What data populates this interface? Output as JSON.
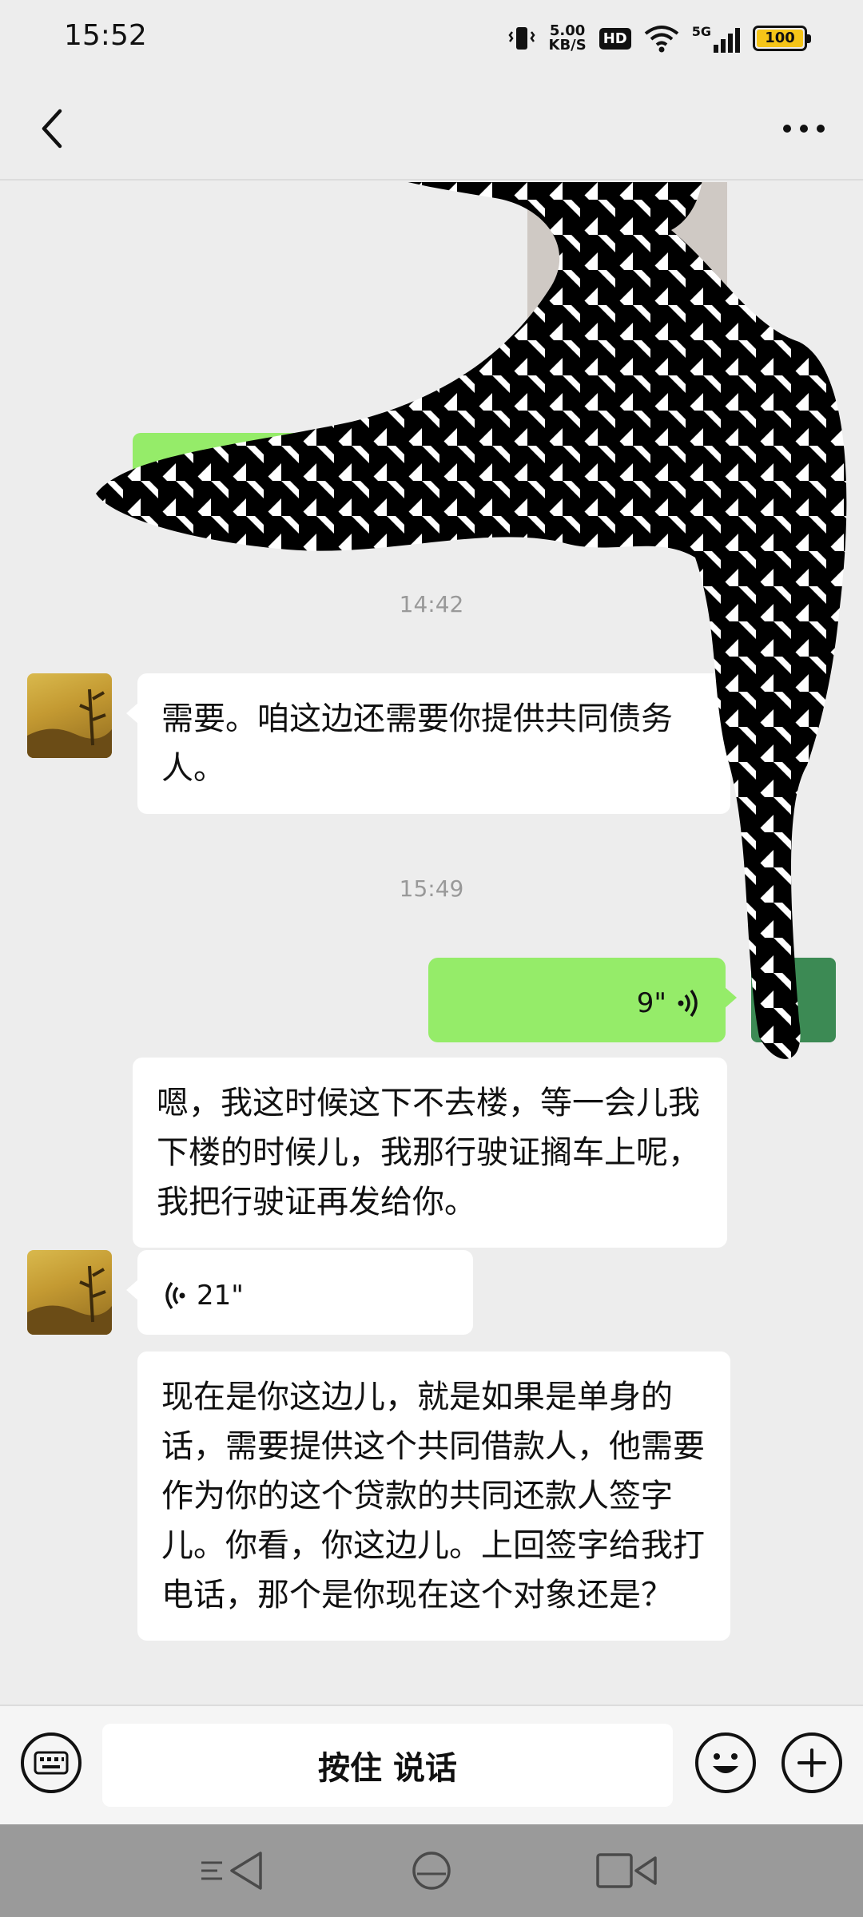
{
  "status_bar": {
    "time": "15:52",
    "net_speed": "5.00",
    "net_unit": "KB/S",
    "hd_badge": "HD",
    "signal_label": "5G",
    "battery": "100"
  },
  "chat": {
    "timestamp_1": "14:42",
    "message_1": "需要。咱这边还需要你提供共同债务人。",
    "timestamp_2": "15:49",
    "voice_out_duration": "9\"",
    "message_2": "嗯，我这时候这下不去楼，等一会儿我下楼的时候儿，我那行驶证搁车上呢，我把行驶证再发给你。",
    "voice_in_duration": "21\"",
    "message_3": "现在是你这边儿，就是如果是单身的话，需要提供这个共同借款人，他需要作为你的这个贷款的共同还款人签字儿。你看，你这边儿。上回签字给我打电话，那个是你现在这个对象还是？"
  },
  "input_bar": {
    "hold_to_talk": "按住 说话"
  },
  "icons": {
    "back": "chevron-left-icon",
    "more": "ellipsis-icon",
    "keyboard": "keyboard-icon",
    "emoji": "smiley-icon",
    "plus": "plus-icon",
    "voice": "voice-wave-icon"
  },
  "colors": {
    "outgoing_bubble": "#95ec69",
    "incoming_bubble": "#ffffff",
    "background": "#ededed"
  }
}
